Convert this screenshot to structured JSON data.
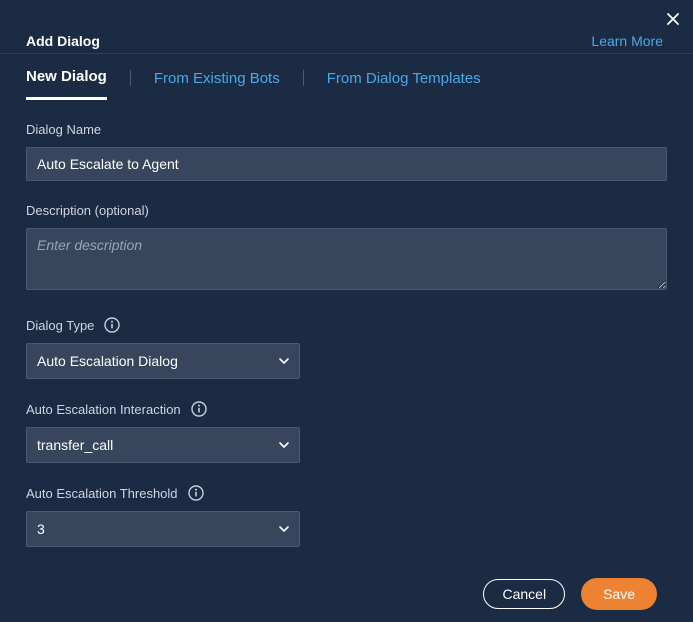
{
  "header": {
    "title": "Add Dialog",
    "learn_more": "Learn More"
  },
  "tabs": {
    "new_dialog": "New Dialog",
    "from_existing": "From Existing Bots",
    "from_templates": "From Dialog Templates"
  },
  "fields": {
    "dialog_name": {
      "label": "Dialog Name",
      "value": "Auto Escalate to Agent"
    },
    "description": {
      "label": "Description (optional)",
      "placeholder": "Enter description",
      "value": ""
    },
    "dialog_type": {
      "label": "Dialog Type",
      "value": "Auto Escalation Dialog"
    },
    "escalation_interaction": {
      "label": "Auto Escalation Interaction",
      "value": "transfer_call"
    },
    "escalation_threshold": {
      "label": "Auto Escalation Threshold",
      "value": "3"
    }
  },
  "buttons": {
    "cancel": "Cancel",
    "save": "Save"
  }
}
